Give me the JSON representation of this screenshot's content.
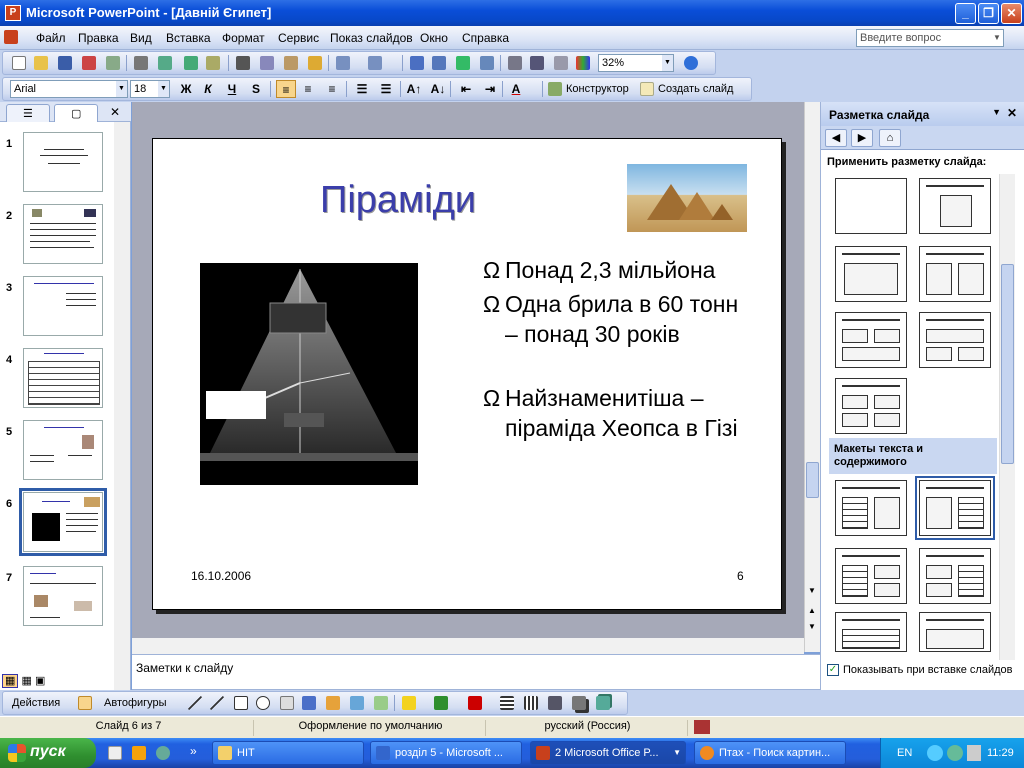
{
  "window": {
    "title": "Microsoft PowerPoint - [Давній Єгипет]"
  },
  "menu": {
    "items": [
      "Файл",
      "Правка",
      "Вид",
      "Вставка",
      "Формат",
      "Сервис",
      "Показ слайдов",
      "Окно",
      "Справка"
    ],
    "question_placeholder": "Введите вопрос"
  },
  "toolbar": {
    "zoom": "32%",
    "font_name": "Arial",
    "font_size": "18",
    "bold": "Ж",
    "italic": "К",
    "underline": "Ч",
    "shadow": "S",
    "designer": "Конструктор",
    "new_slide": "Создать слайд"
  },
  "slides_pane": {
    "slides": [
      "1",
      "2",
      "3",
      "4",
      "5",
      "6",
      "7"
    ],
    "selected": "6"
  },
  "slide": {
    "title": "Піраміди",
    "bullet_symbol": "Ω",
    "bullets": [
      "Понад 2,3 мільйона",
      "Одна брила в 60 тонн – понад 30 років",
      "Найзнаменитіша – піраміда Хеопса в Гізі"
    ],
    "date": "16.10.2006",
    "number": "6"
  },
  "notes": {
    "placeholder": "Заметки к слайду"
  },
  "task_pane": {
    "title": "Разметка слайда",
    "apply_label": "Применить разметку слайда:",
    "section_label": "Макеты текста и содержимого",
    "show_on_insert": "Показывать при вставке слайдов"
  },
  "draw_toolbar": {
    "actions": "Действия",
    "autoshapes": "Автофигуры"
  },
  "status": {
    "slide": "Слайд 6 из 7",
    "design": "Оформление по умолчанию",
    "language": "русский (Россия)"
  },
  "taskbar": {
    "start": "пуск",
    "tasks": [
      "HIT",
      "розділ 5 - Microsoft ...",
      "2 Microsoft Office P...",
      "Птах - Поиск картин..."
    ],
    "lang": "EN",
    "clock": "11:29"
  }
}
